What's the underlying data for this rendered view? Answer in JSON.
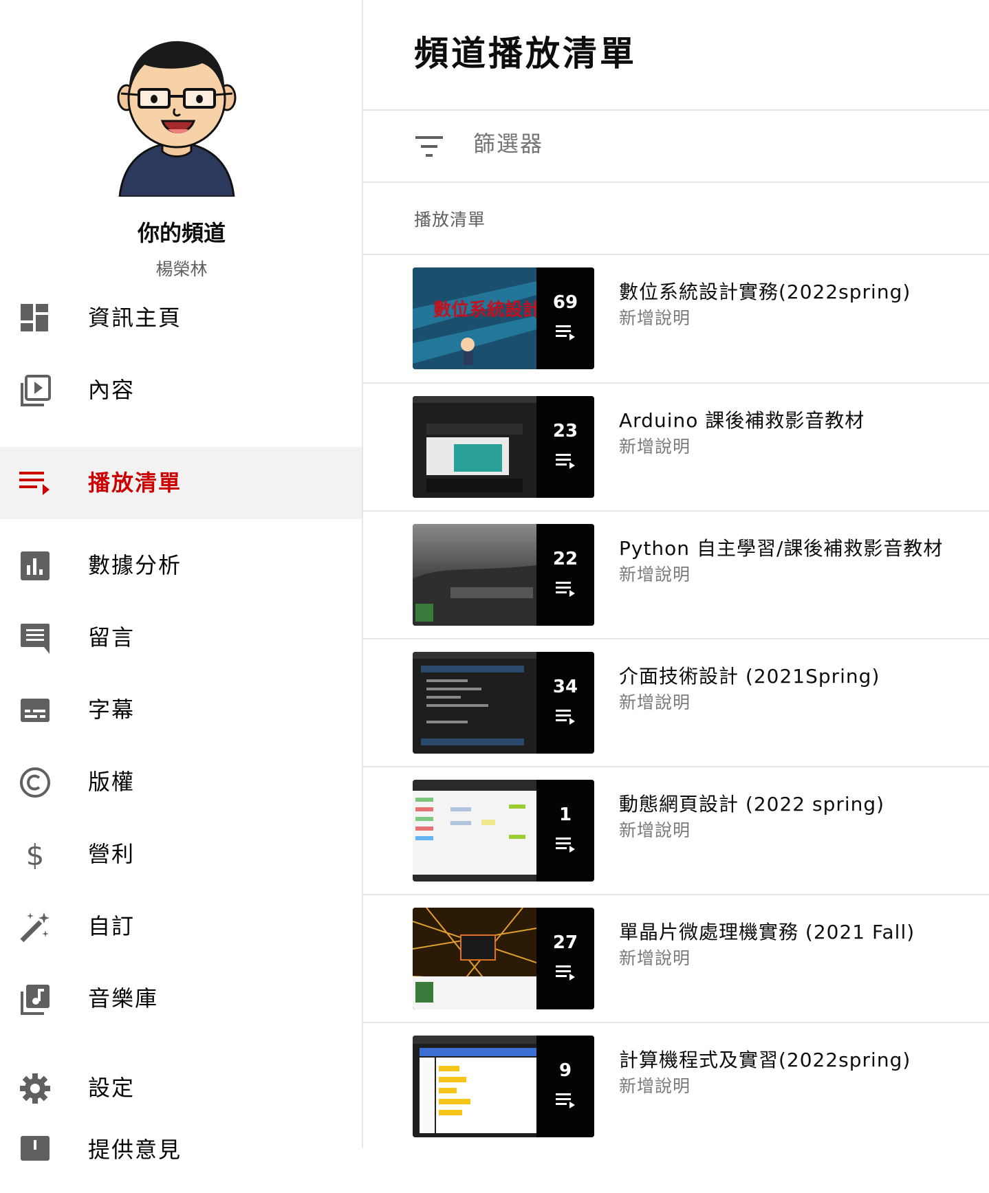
{
  "sidebar": {
    "channel_title": "你的頻道",
    "channel_owner": "楊榮林",
    "items": [
      {
        "label": "資訊主頁",
        "icon": "dashboard-icon"
      },
      {
        "label": "內容",
        "icon": "video-library-icon"
      },
      {
        "label": "播放清單",
        "icon": "playlist-icon",
        "active": true
      },
      {
        "label": "數據分析",
        "icon": "analytics-icon"
      },
      {
        "label": "留言",
        "icon": "comment-icon"
      },
      {
        "label": "字幕",
        "icon": "subtitles-icon"
      },
      {
        "label": "版權",
        "icon": "copyright-icon"
      },
      {
        "label": "營利",
        "icon": "dollar-icon"
      },
      {
        "label": "自訂",
        "icon": "magic-wand-icon"
      },
      {
        "label": "音樂庫",
        "icon": "music-library-icon"
      },
      {
        "label": "設定",
        "icon": "gear-icon"
      },
      {
        "label": "提供意見",
        "icon": "feedback-icon"
      }
    ]
  },
  "main": {
    "title": "頻道播放清單",
    "filter_placeholder": "篩選器",
    "section_header": "播放清單",
    "playlists": [
      {
        "title": "數位系統設計實務(2022spring)",
        "description": "新增說明",
        "count": "69"
      },
      {
        "title": "Arduino 課後補救影音教材",
        "description": "新增說明",
        "count": "23"
      },
      {
        "title": "Python 自主學習/課後補救影音教材",
        "description": "新增說明",
        "count": "22"
      },
      {
        "title": "介面技術設計 (2021Spring)",
        "description": "新增說明",
        "count": "34"
      },
      {
        "title": "動態網頁設計 (2022 spring)",
        "description": "新增說明",
        "count": "1"
      },
      {
        "title": "單晶片微處理機實務 (2021 Fall)",
        "description": "新增說明",
        "count": "27"
      },
      {
        "title": "計算機程式及實習(2022spring)",
        "description": "新增說明",
        "count": "9"
      }
    ]
  },
  "colors": {
    "accent": "#cc0000",
    "active_bg": "#f2f2f2",
    "divider": "#e5e5e5",
    "secondary_text": "#606060"
  }
}
